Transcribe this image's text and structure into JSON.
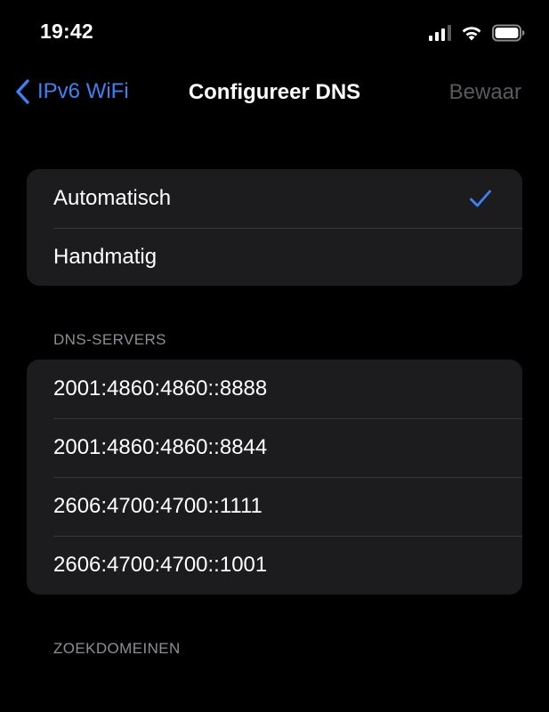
{
  "status_bar": {
    "time": "19:42",
    "signal_icon": "signal-icon",
    "wifi_icon": "wifi-icon",
    "battery_icon": "battery-icon"
  },
  "nav": {
    "back_label": "IPv6 WiFi",
    "back_icon": "chevron-left-icon",
    "title": "Configureer DNS",
    "save_label": "Bewaar"
  },
  "mode_options": [
    {
      "label": "Automatisch",
      "selected": true
    },
    {
      "label": "Handmatig",
      "selected": false
    }
  ],
  "dns_section": {
    "header": "DNS-SERVERS",
    "servers": [
      "2001:4860:4860::8888",
      "2001:4860:4860::8844",
      "2606:4700:4700::1111",
      "2606:4700:4700::1001"
    ]
  },
  "search_domains_section": {
    "header": "ZOEKDOMEINEN"
  },
  "colors": {
    "accent": "#3b82f6",
    "background": "#000000",
    "group_background": "#1c1c1e",
    "separator": "#38383a",
    "secondary_text": "#8e8e93",
    "disabled_text": "#5a5a5e"
  }
}
